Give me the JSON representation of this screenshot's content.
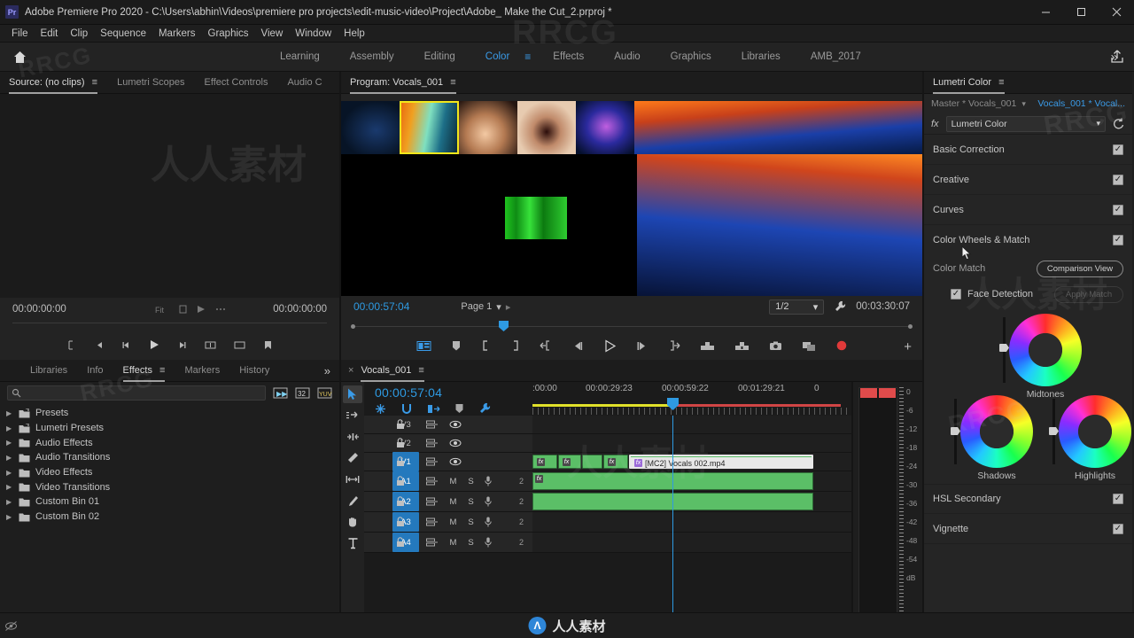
{
  "titlebar": {
    "app_icon": "premiere-pro-logo",
    "title": "Adobe Premiere Pro 2020 - C:\\Users\\abhin\\Videos\\premiere pro projects\\edit-music-video\\Project\\Adobe_ Make the Cut_2.prproj *",
    "minimize": "—",
    "maximize": "☐",
    "close": "✕"
  },
  "menubar": {
    "items": [
      "File",
      "Edit",
      "Clip",
      "Sequence",
      "Markers",
      "Graphics",
      "View",
      "Window",
      "Help"
    ]
  },
  "workspace": {
    "home_icon": "home-icon",
    "tabs": [
      {
        "label": "Learning",
        "active": false
      },
      {
        "label": "Assembly",
        "active": false
      },
      {
        "label": "Editing",
        "active": false
      },
      {
        "label": "Color",
        "active": true
      },
      {
        "label": "Effects",
        "active": false
      },
      {
        "label": "Audio",
        "active": false
      },
      {
        "label": "Graphics",
        "active": false
      },
      {
        "label": "Libraries",
        "active": false
      },
      {
        "label": "AMB_2017",
        "active": false
      }
    ],
    "overflow": "»",
    "share_icon": "share-export-icon"
  },
  "source_panel": {
    "tabs": [
      {
        "label": "Source: (no clips)",
        "active": true
      },
      {
        "label": "Lumetri Scopes",
        "active": false
      },
      {
        "label": "Effect Controls",
        "active": false
      },
      {
        "label": "Audio C",
        "active": false
      }
    ],
    "overflow": "»",
    "timecode_left": "00:00:00:00",
    "timecode_right": "00:00:00:00"
  },
  "program_panel": {
    "tab": "Program: Vocals_001",
    "timecode_current": "00:00:57:04",
    "page_label": "Page 1",
    "fit_value": "1/2",
    "timecode_duration": "00:03:30:07",
    "transport": [
      "export-frame-icon",
      "marker-icon",
      "mark-in-icon",
      "mark-out-icon",
      "go-to-in-icon",
      "step-back-icon",
      "play-icon",
      "step-forward-icon",
      "go-to-out-icon",
      "lift-icon",
      "extract-icon",
      "export-frame-camera-icon",
      "comparison-view-icon",
      "record-icon"
    ],
    "add_button": "+"
  },
  "effects_panel": {
    "tabs": [
      {
        "label": "Libraries",
        "active": false
      },
      {
        "label": "Info",
        "active": false
      },
      {
        "label": "Effects",
        "active": true
      },
      {
        "label": "Markers",
        "active": false
      },
      {
        "label": "History",
        "active": false
      }
    ],
    "overflow": "»",
    "search_placeholder": "",
    "search_value": "",
    "filter_icons": [
      "accelerated-effect-icon",
      "32-bit-color-icon",
      "ycbcr-color-icon"
    ],
    "tree": [
      {
        "label": "Presets",
        "icon": "preset-bin-icon"
      },
      {
        "label": "Lumetri Presets",
        "icon": "preset-bin-icon"
      },
      {
        "label": "Audio Effects",
        "icon": "folder-icon"
      },
      {
        "label": "Audio Transitions",
        "icon": "folder-icon"
      },
      {
        "label": "Video Effects",
        "icon": "folder-icon"
      },
      {
        "label": "Video Transitions",
        "icon": "folder-icon"
      },
      {
        "label": "Custom Bin 01",
        "icon": "folder-icon"
      },
      {
        "label": "Custom Bin 02",
        "icon": "folder-icon"
      }
    ]
  },
  "timeline_panel": {
    "close_icon": "×",
    "title": "Vocals_001",
    "menu_icon": "≡",
    "timecode": "00:00:57:04",
    "toggles": [
      "snap-linked-selection-icon",
      "snap-icon",
      "linked-selection-icon",
      "marker-icon",
      "settings-wrench-icon"
    ],
    "ruler_labels": [
      ":00:00",
      "00:00:29:23",
      "00:00:59:22",
      "00:01:29:21",
      "0"
    ],
    "tools": [
      {
        "name": "selection-tool",
        "active": true
      },
      {
        "name": "track-select-forward-tool",
        "active": false
      },
      {
        "name": "ripple-edit-tool",
        "active": false
      },
      {
        "name": "razor-tool",
        "active": false
      },
      {
        "name": "slip-tool",
        "active": false
      },
      {
        "name": "pen-tool",
        "active": false
      },
      {
        "name": "hand-tool",
        "active": false
      },
      {
        "name": "type-tool",
        "active": false
      }
    ],
    "tracks": [
      {
        "name": "V3",
        "type": "video",
        "selected": false,
        "eye": true
      },
      {
        "name": "V2",
        "type": "video",
        "selected": false,
        "eye": true
      },
      {
        "name": "V1",
        "type": "video",
        "selected": true,
        "eye": true
      },
      {
        "name": "A1",
        "type": "audio",
        "selected": true,
        "mute": "M",
        "solo": "S",
        "channels": "2"
      },
      {
        "name": "A2",
        "type": "audio",
        "selected": true,
        "mute": "M",
        "solo": "S",
        "channels": "2"
      },
      {
        "name": "A3",
        "type": "audio",
        "selected": true,
        "mute": "M",
        "solo": "S",
        "channels": "2"
      },
      {
        "name": "A4",
        "type": "audio",
        "selected": true,
        "mute": "M",
        "solo": "S",
        "channels": "2"
      }
    ],
    "clip_label": "[MC2] Vocals  002.mp4"
  },
  "audio_meters": {
    "scale": [
      "0",
      "-6",
      "-12",
      "-18",
      "-24",
      "-30",
      "-36",
      "-42",
      "-48",
      "-54",
      "dB"
    ]
  },
  "lumetri": {
    "tab": "Lumetri Color",
    "menu_icon": "≡",
    "master_label": "Master * Vocals_001",
    "clip_label": "Vocals_001 * Vocal...",
    "fx_label": "fx",
    "effect_name": "Lumetri Color",
    "reset_icon": "reset-icon",
    "sections": [
      {
        "name": "Basic Correction",
        "checked": true
      },
      {
        "name": "Creative",
        "checked": true
      },
      {
        "name": "Curves",
        "checked": true
      },
      {
        "name": "Color Wheels & Match",
        "checked": true
      },
      {
        "name": "HSL Secondary",
        "checked": true
      },
      {
        "name": "Vignette",
        "checked": true
      }
    ],
    "color_match_label": "Color Match",
    "comparison_view_button": "Comparison View",
    "face_detection_label": "Face Detection",
    "face_detection_checked": true,
    "apply_match_button": "Apply Match",
    "apply_match_enabled": false,
    "wheels": [
      {
        "label": "Midtones"
      },
      {
        "label": "Shadows"
      },
      {
        "label": "Highlights"
      }
    ]
  },
  "watermarks": {
    "rrcg": "RRCG",
    "cn": "人人素材"
  },
  "statusbar": {
    "left_icon": "eye-slash-icon",
    "brand_mark": "Λ",
    "brand_name": "人人素材"
  },
  "colors": {
    "accent_blue": "#2e9ae2",
    "track_selected": "#2479bd",
    "clip_green": "#5bbf67",
    "record_red": "#e03a3a",
    "meter_red": "#e04b4b"
  }
}
